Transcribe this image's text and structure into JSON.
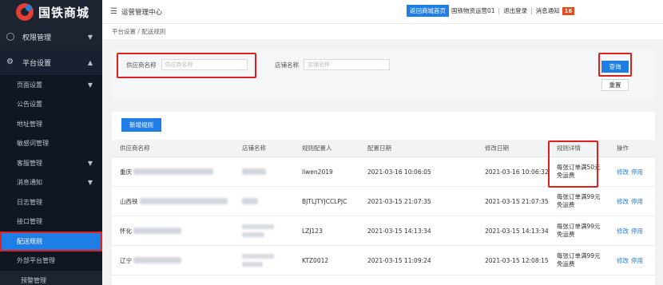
{
  "brand": {
    "name": "国铁商城",
    "colors": {
      "primary": "#1e7ee6",
      "sidebar": "#1c2331",
      "highlight": "#e01f1f"
    }
  },
  "sidebar": {
    "groups": [
      {
        "label": "权限管理",
        "icon": "shield-icon"
      },
      {
        "label": "平台设置",
        "icon": "gear-icon"
      }
    ],
    "items": [
      {
        "label": "页面设置",
        "has_caret": true
      },
      {
        "label": "公告设置"
      },
      {
        "label": "地址管理"
      },
      {
        "label": "敏感词管理"
      },
      {
        "label": "客服管理",
        "has_caret": true
      },
      {
        "label": "消息通知",
        "has_caret": true
      },
      {
        "label": "日志管理"
      },
      {
        "label": "接口管理"
      },
      {
        "label": "配送规则",
        "active": true
      },
      {
        "label": "外部平台管理"
      }
    ],
    "bottom": "预警管理"
  },
  "topbar": {
    "title": "运营管理中心",
    "home_button": "返回商城首页",
    "user": "国铁物资运营01",
    "logout": "退出登录",
    "notice": "消息通知",
    "notice_count": "16"
  },
  "breadcrumb": "平台设置 / 配送规则",
  "search": {
    "supplier_label": "供应商名称",
    "supplier_placeholder": "供应商名称",
    "shop_label": "店铺名称",
    "shop_placeholder": "店铺名称",
    "query_button": "查询",
    "reset_button": "重置"
  },
  "table": {
    "add_button": "新增规则",
    "columns": [
      "供应商名称",
      "店铺名称",
      "规则配置人",
      "配置日期",
      "修改日期",
      "规则详情",
      "操作"
    ],
    "rows": [
      {
        "supplier": "重庆",
        "configurer": "liwen2019",
        "config_date": "2021-03-16 10:06:05",
        "modify_date": "2021-03-16 10:06:32",
        "rule_line1": "每张订单满50元",
        "rule_line2": "免运费"
      },
      {
        "supplier": "山西铁",
        "configurer": "BJTLJTYJCCLPJC",
        "config_date": "2021-03-15 21:07:35",
        "modify_date": "2021-03-15 21:07:35",
        "rule_line1": "每张订单满99元",
        "rule_line2": "免运费"
      },
      {
        "supplier": "怀化",
        "configurer": "LZJ123",
        "config_date": "2021-03-15 14:13:34",
        "modify_date": "2021-03-15 14:13:34",
        "rule_line1": "每张订单满99元",
        "rule_line2": "免运费"
      },
      {
        "supplier": "辽宁",
        "configurer": "KTZ0012",
        "config_date": "2021-03-15 11:09:24",
        "modify_date": "2021-03-15 12:08:15",
        "rule_line1": "每张订单满99元",
        "rule_line2": "免运费"
      }
    ],
    "actions": {
      "edit": "修改",
      "disable": "停用"
    }
  }
}
